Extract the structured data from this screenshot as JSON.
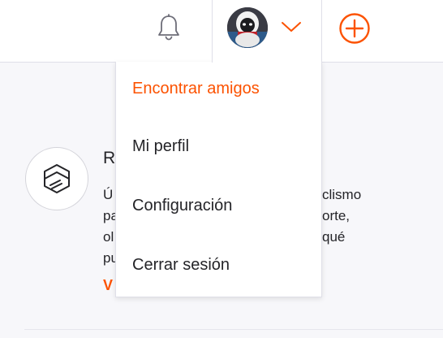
{
  "colors": {
    "accent": "#fc5200",
    "text": "#242428",
    "icon_gray": "#6d6d78"
  },
  "header": {
    "notifications_icon": "bell-icon",
    "menu_icon": "chevron-down-icon",
    "add_icon": "plus-circle-icon"
  },
  "card": {
    "icon": "box-logo-icon",
    "heading": "R",
    "lines": [
      "Ú",
      "pa",
      "ol",
      "pu"
    ],
    "right_fragments": [
      "clismo",
      "orte,",
      "qué"
    ],
    "link": "V"
  },
  "dropdown": {
    "items": [
      {
        "label": "Encontrar amigos"
      },
      {
        "label": "Mi perfil"
      },
      {
        "label": "Configuración"
      },
      {
        "label": "Cerrar sesión"
      }
    ]
  }
}
